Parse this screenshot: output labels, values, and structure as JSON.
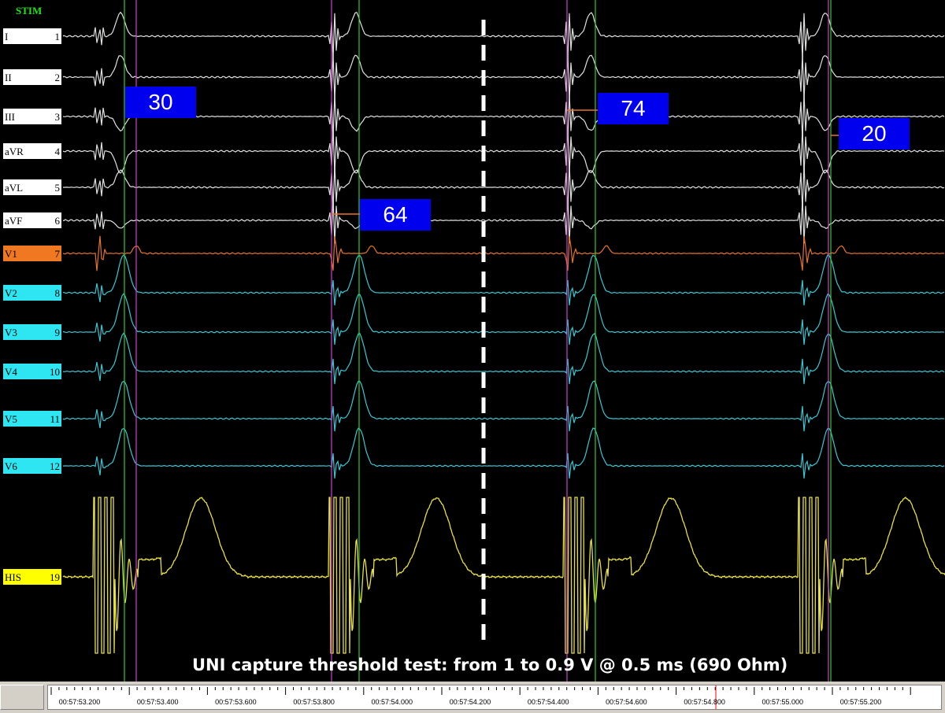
{
  "stim_label": "STIM",
  "channels": [
    {
      "name": "I",
      "num": "1",
      "color": "#ffffff",
      "trace": "#e0e0e0",
      "type": "limb"
    },
    {
      "name": "II",
      "num": "2",
      "color": "#ffffff",
      "trace": "#e0e0e0",
      "type": "limb"
    },
    {
      "name": "III",
      "num": "3",
      "color": "#ffffff",
      "trace": "#e0e0e0",
      "type": "limb"
    },
    {
      "name": "aVR",
      "num": "4",
      "color": "#ffffff",
      "trace": "#e0e0e0",
      "type": "limb"
    },
    {
      "name": "aVL",
      "num": "5",
      "color": "#ffffff",
      "trace": "#e0e0e0",
      "type": "limb"
    },
    {
      "name": "aVF",
      "num": "6",
      "color": "#ffffff",
      "trace": "#e0e0e0",
      "type": "limb"
    },
    {
      "name": "V1",
      "num": "7",
      "color": "#f07820",
      "trace": "#e8742a",
      "type": "v1"
    },
    {
      "name": "V2",
      "num": "8",
      "color": "#2ee6f2",
      "trace": "#38c8d4",
      "type": "prec"
    },
    {
      "name": "V3",
      "num": "9",
      "color": "#2ee6f2",
      "trace": "#38c8d4",
      "type": "prec"
    },
    {
      "name": "V4",
      "num": "10",
      "color": "#2ee6f2",
      "trace": "#38c8d4",
      "type": "prec"
    },
    {
      "name": "V5",
      "num": "11",
      "color": "#2ee6f2",
      "trace": "#38c8d4",
      "type": "prec"
    },
    {
      "name": "V6",
      "num": "12",
      "color": "#2ee6f2",
      "trace": "#38c8d4",
      "type": "prec"
    },
    {
      "name": "HIS",
      "num": "19",
      "color": "#ffff00",
      "trace": "#e8e040",
      "type": "his"
    }
  ],
  "intervals": [
    {
      "value": "30"
    },
    {
      "value": "64"
    },
    {
      "value": "74"
    },
    {
      "value": "20"
    }
  ],
  "caption": "UNI capture threshold test: from 1 to 0.9 V @ 0.5 ms (690 Ohm)",
  "time_labels": [
    "00:57:53.200",
    "00:57:53.400",
    "00:57:53.600",
    "00:57:53.800",
    "00:57:54.000",
    "00:57:54.200",
    "00:57:54.400",
    "00:57:54.600",
    "00:57:54.800",
    "00:57:55.000",
    "00:57:55.200"
  ],
  "colors": {
    "background": "#000000",
    "interval_box": "#0000ee",
    "calipers_green": "#2ecc2e",
    "calipers_magenta": "#d040d0",
    "cursor_red": "#ff0000"
  }
}
